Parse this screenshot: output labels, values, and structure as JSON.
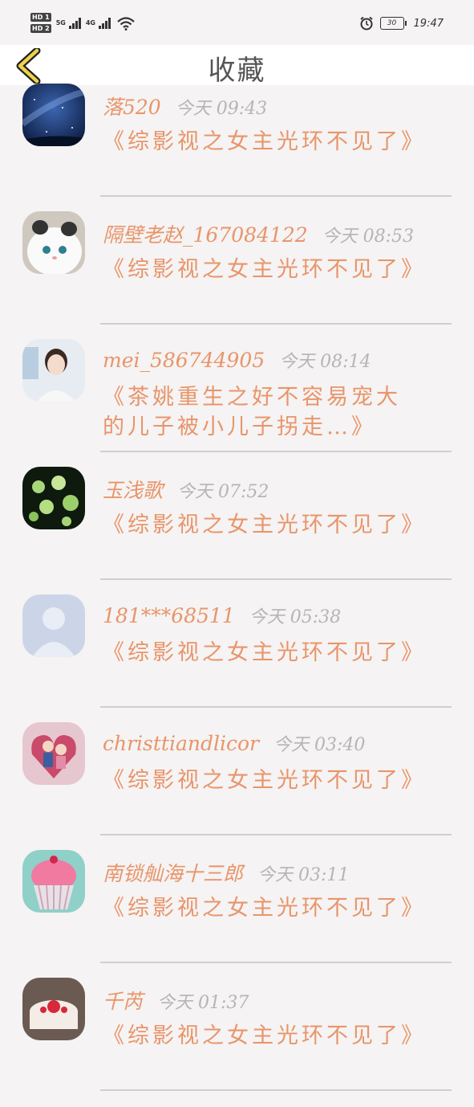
{
  "status_bar": {
    "sim1": "HD 1",
    "sim2": "HD 2",
    "net1": "5G",
    "net2": "4G",
    "battery": "30",
    "time": "19:47"
  },
  "header": {
    "title": "收藏",
    "back_icon": "chevron-left-icon"
  },
  "colors": {
    "accent": "#e8956a",
    "muted": "#b5b5b5",
    "background": "#f5f3f3"
  },
  "items": [
    {
      "name": "落520",
      "date": "今天 09:43",
      "title": "《综影视之女主光环不见了》",
      "avatar": "starry-sky"
    },
    {
      "name": "隔壁老赵_167084122",
      "date": "今天 08:53",
      "title": "《综影视之女主光环不见了》",
      "avatar": "white-cat"
    },
    {
      "name": "mei_586744905",
      "date": "今天 08:14",
      "title": "《茶姚重生之好不容易宠大的儿子被小儿子拐走…》",
      "avatar": "woman-photo"
    },
    {
      "name": "玉浅歌",
      "date": "今天 07:52",
      "title": "《综影视之女主光环不见了》",
      "avatar": "green-flowers"
    },
    {
      "name": "181***68511",
      "date": "今天 05:38",
      "title": "《综影视之女主光环不见了》",
      "avatar": "default-user"
    },
    {
      "name": "christtiandlicor",
      "date": "今天 03:40",
      "title": "《综影视之女主光环不见了》",
      "avatar": "cartoon-couple"
    },
    {
      "name": "南锁舢海十三郎",
      "date": "今天 03:11",
      "title": "《综影视之女主光环不见了》",
      "avatar": "cupcake"
    },
    {
      "name": "千芮",
      "date": "今天 01:37",
      "title": "《综影视之女主光环不见了》",
      "avatar": "cake"
    }
  ]
}
